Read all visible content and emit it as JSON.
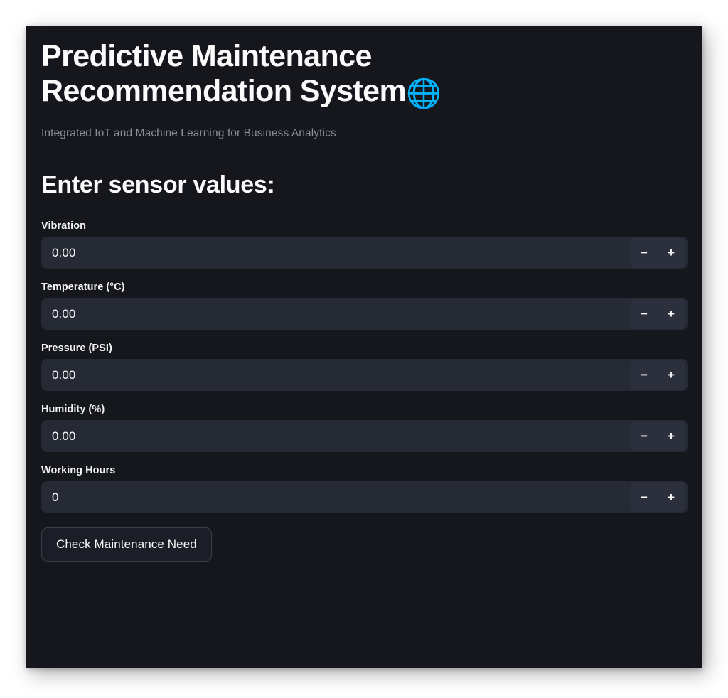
{
  "app": {
    "background_color": "#ffffff",
    "card_color": "#15171c",
    "title": "Predictive Maintenance Recommendation System",
    "title_icon": "globe-with-meridians-icon",
    "title_icon_glyph": "🌐",
    "subtitle": "Integrated IoT and Machine Learning for Business Analytics",
    "text_color": "#fafafa",
    "muted_text_color": "#8b8f99",
    "input_background": "#262a35"
  },
  "form": {
    "heading": "Enter sensor values:",
    "stepper": {
      "decrement_label": "−",
      "increment_label": "+"
    },
    "fields": [
      {
        "label": "Vibration",
        "value": "0.00",
        "placeholder": "0.00"
      },
      {
        "label": "Temperature (°C)",
        "value": "0.00",
        "placeholder": "0.00"
      },
      {
        "label": "Pressure (PSI)",
        "value": "0.00",
        "placeholder": "0.00"
      },
      {
        "label": "Humidity (%)",
        "value": "0.00",
        "placeholder": "0.00"
      },
      {
        "label": "Working Hours",
        "value": "0",
        "placeholder": "0"
      }
    ],
    "submit_label": "Check Maintenance Need"
  }
}
